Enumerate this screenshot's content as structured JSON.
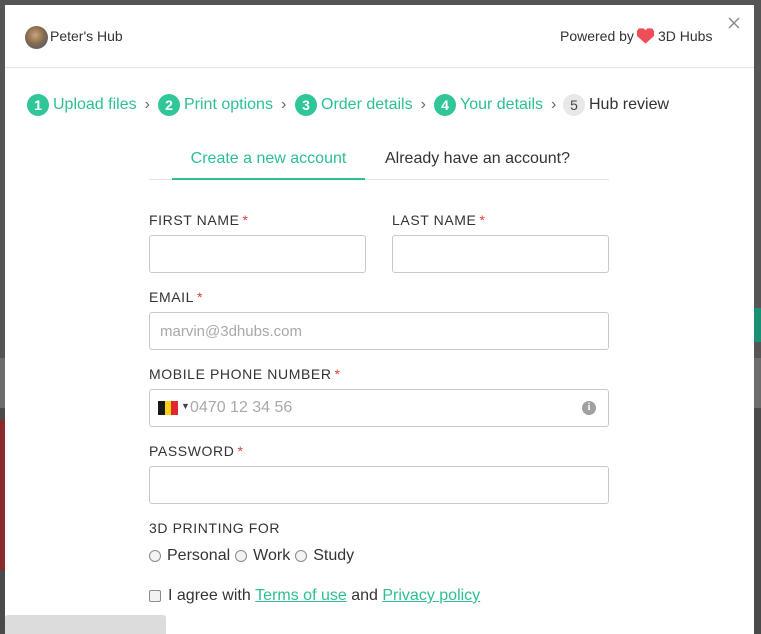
{
  "header": {
    "hub_name": "Peter's Hub",
    "powered_by": "Powered by",
    "brand": "3D Hubs",
    "brand_color": "#f04e57"
  },
  "steps": [
    {
      "number": "1",
      "label": "Upload files",
      "status": "done"
    },
    {
      "number": "2",
      "label": "Print options",
      "status": "done"
    },
    {
      "number": "3",
      "label": "Order details",
      "status": "done"
    },
    {
      "number": "4",
      "label": "Your details",
      "status": "active"
    },
    {
      "number": "5",
      "label": "Hub review",
      "status": "pending"
    }
  ],
  "tabs": {
    "create": "Create a new account",
    "login": "Already have an account?"
  },
  "form": {
    "first_name_label": "FIRST NAME",
    "last_name_label": "LAST NAME",
    "email_label": "EMAIL",
    "email_placeholder": "marvin@3dhubs.com",
    "phone_label": "MOBILE PHONE NUMBER",
    "phone_placeholder": "0470 12 34 56",
    "phone_country": "belgium-flag-icon",
    "password_label": "PASSWORD",
    "required_mark": "*",
    "printing_for_label": "3D PRINTING FOR",
    "printing_options": [
      "Personal",
      "Work",
      "Study"
    ],
    "agree_text": "I agree with",
    "terms_link": "Terms of use",
    "and_text": "and",
    "privacy_link": "Privacy policy"
  },
  "colors": {
    "accent": "#2cbf94",
    "required": "#e23d3d"
  }
}
